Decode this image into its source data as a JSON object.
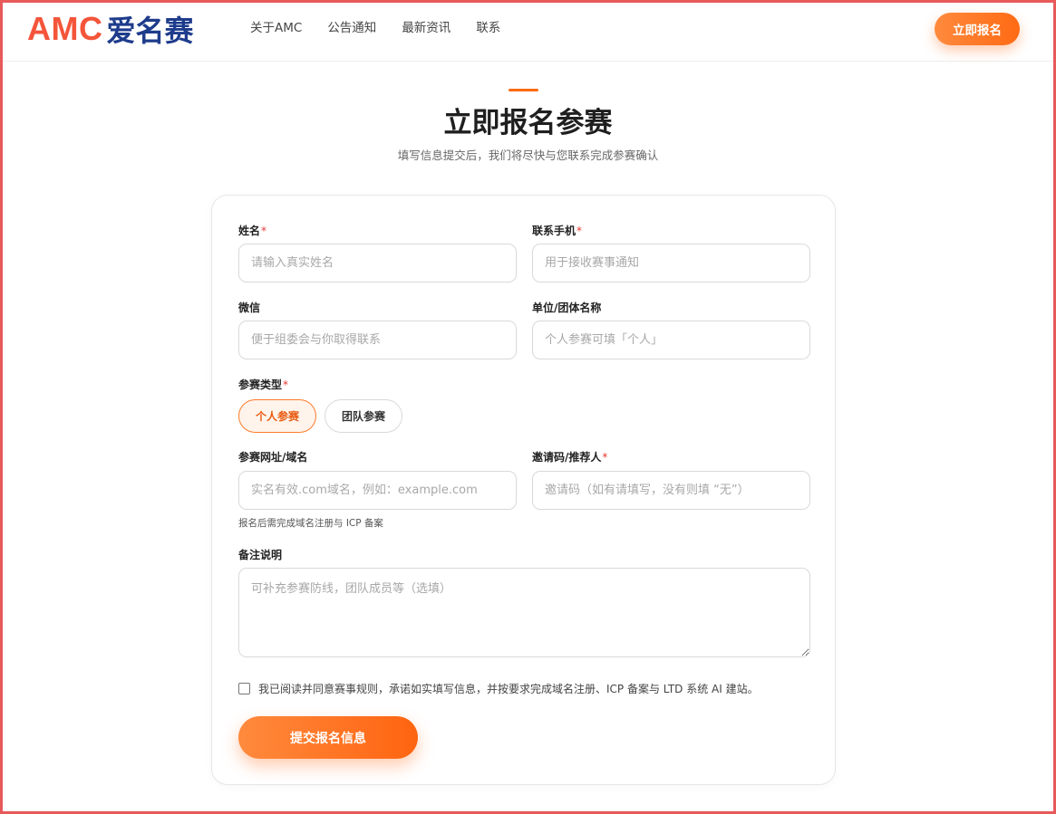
{
  "header": {
    "logo_latin": "AMC",
    "logo_cn": "爱名赛",
    "nav": [
      "关于AMC",
      "公告通知",
      "最新资讯",
      "联系"
    ],
    "cta_label": "立即报名"
  },
  "hero": {
    "title": "立即报名参赛",
    "subtitle": "填写信息提交后，我们将尽快与您联系完成参赛确认"
  },
  "form": {
    "name": {
      "label": "姓名",
      "required": "*",
      "placeholder": "请输入真实姓名"
    },
    "phone": {
      "label": "联系手机",
      "required": "*",
      "placeholder": "用于接收赛事通知"
    },
    "wechat": {
      "label": "微信",
      "placeholder": "便于组委会与你取得联系"
    },
    "org": {
      "label": "单位/团体名称",
      "placeholder": "个人参赛可填「个人」"
    },
    "type": {
      "label": "参赛类型",
      "required": "*",
      "options": [
        "个人参赛",
        "团队参赛"
      ],
      "selected": "个人参赛"
    },
    "site": {
      "label": "参赛网址/域名",
      "placeholder": "实名有效.com域名，例如：example.com",
      "hint": "报名后需完成域名注册与 ICP 备案"
    },
    "invite": {
      "label": "邀请码/推荐人",
      "required": "*",
      "placeholder": "邀请码（如有请填写，没有则填 “无”）"
    },
    "notes": {
      "label": "备注说明",
      "placeholder": "可补充参赛防线，团队成员等（选填）"
    },
    "agree_text": "我已阅读并同意赛事规则，承诺如实填写信息，并按要求完成域名注册、ICP 备案与 LTD 系统 AI 建站。",
    "agree_checked": false,
    "submit_label": "提交报名信息"
  },
  "colors": {
    "accent": "#ff6a14",
    "logo_red": "#f4553a",
    "logo_blue": "#1e3c8c",
    "frame": "#e8595a"
  }
}
